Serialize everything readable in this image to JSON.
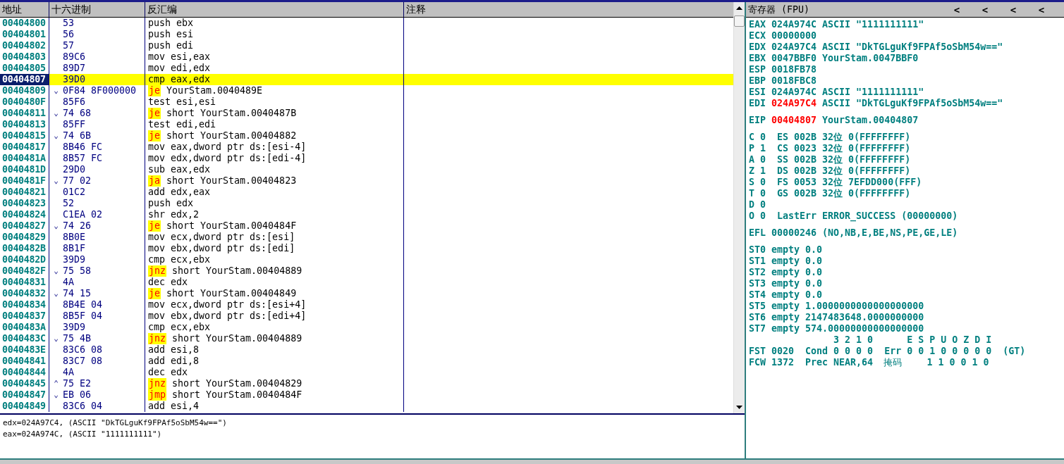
{
  "disassembly": {
    "columns": [
      "地址",
      "十六进制",
      "反汇编",
      "注释"
    ],
    "rows": [
      {
        "address": "00404800",
        "hex": "53",
        "kind": "plain",
        "instruction": "push ebx",
        "selected": false
      },
      {
        "address": "00404801",
        "hex": "56",
        "kind": "plain",
        "instruction": "push esi",
        "selected": false
      },
      {
        "address": "00404802",
        "hex": "57",
        "kind": "plain",
        "instruction": "push edi",
        "selected": false
      },
      {
        "address": "00404803",
        "hex": "89C6",
        "kind": "plain",
        "instruction": "mov esi,eax",
        "selected": false
      },
      {
        "address": "00404805",
        "hex": "89D7",
        "kind": "plain",
        "instruction": "mov edi,edx",
        "selected": false
      },
      {
        "address": "00404807",
        "hex": "39D0",
        "kind": "plain",
        "instruction": "cmp eax,edx",
        "selected": true
      },
      {
        "address": "00404809",
        "arrow": "⌄",
        "hex": "0F84 8F000000",
        "kind": "jump",
        "mnemonic": "je",
        "operands": "YourStam.0040489E",
        "selected": false
      },
      {
        "address": "0040480F",
        "hex": "85F6",
        "kind": "plain",
        "instruction": "test esi,esi",
        "selected": false
      },
      {
        "address": "00404811",
        "arrow": "⌄",
        "hex": "74 68",
        "kind": "jump",
        "mnemonic": "je",
        "operands": "short YourStam.0040487B",
        "selected": false
      },
      {
        "address": "00404813",
        "hex": "85FF",
        "kind": "plain",
        "instruction": "test edi,edi",
        "selected": false
      },
      {
        "address": "00404815",
        "arrow": "⌄",
        "hex": "74 6B",
        "kind": "jump",
        "mnemonic": "je",
        "operands": "short YourStam.00404882",
        "selected": false
      },
      {
        "address": "00404817",
        "hex": "8B46 FC",
        "kind": "plain",
        "instruction": "mov eax,dword ptr ds:[esi-4]",
        "selected": false
      },
      {
        "address": "0040481A",
        "hex": "8B57 FC",
        "kind": "plain",
        "instruction": "mov edx,dword ptr ds:[edi-4]",
        "selected": false
      },
      {
        "address": "0040481D",
        "hex": "29D0",
        "kind": "plain",
        "instruction": "sub eax,edx",
        "selected": false
      },
      {
        "address": "0040481F",
        "arrow": "⌄",
        "hex": "77 02",
        "kind": "jump",
        "mnemonic": "ja",
        "operands": "short YourStam.00404823",
        "selected": false
      },
      {
        "address": "00404821",
        "hex": "01C2",
        "kind": "plain",
        "instruction": "add edx,eax",
        "selected": false
      },
      {
        "address": "00404823",
        "hex": "52",
        "kind": "plain",
        "instruction": "push edx",
        "selected": false
      },
      {
        "address": "00404824",
        "hex": "C1EA 02",
        "kind": "plain",
        "instruction": "shr edx,2",
        "selected": false
      },
      {
        "address": "00404827",
        "arrow": "⌄",
        "hex": "74 26",
        "kind": "jump",
        "mnemonic": "je",
        "operands": "short YourStam.0040484F",
        "selected": false
      },
      {
        "address": "00404829",
        "hex": "8B0E",
        "kind": "plain",
        "instruction": "mov ecx,dword ptr ds:[esi]",
        "selected": false
      },
      {
        "address": "0040482B",
        "hex": "8B1F",
        "kind": "plain",
        "instruction": "mov ebx,dword ptr ds:[edi]",
        "selected": false
      },
      {
        "address": "0040482D",
        "hex": "39D9",
        "kind": "plain",
        "instruction": "cmp ecx,ebx",
        "selected": false
      },
      {
        "address": "0040482F",
        "arrow": "⌄",
        "hex": "75 58",
        "kind": "jump",
        "mnemonic": "jnz",
        "operands": "short YourStam.00404889",
        "selected": false
      },
      {
        "address": "00404831",
        "hex": "4A",
        "kind": "plain",
        "instruction": "dec edx",
        "selected": false
      },
      {
        "address": "00404832",
        "arrow": "⌄",
        "hex": "74 15",
        "kind": "jump",
        "mnemonic": "je",
        "operands": "short YourStam.00404849",
        "selected": false
      },
      {
        "address": "00404834",
        "hex": "8B4E 04",
        "kind": "plain",
        "instruction": "mov ecx,dword ptr ds:[esi+4]",
        "selected": false
      },
      {
        "address": "00404837",
        "hex": "8B5F 04",
        "kind": "plain",
        "instruction": "mov ebx,dword ptr ds:[edi+4]",
        "selected": false
      },
      {
        "address": "0040483A",
        "hex": "39D9",
        "kind": "plain",
        "instruction": "cmp ecx,ebx",
        "selected": false
      },
      {
        "address": "0040483C",
        "arrow": "⌄",
        "hex": "75 4B",
        "kind": "jump",
        "mnemonic": "jnz",
        "operands": "short YourStam.00404889",
        "selected": false
      },
      {
        "address": "0040483E",
        "hex": "83C6 08",
        "kind": "plain",
        "instruction": "add esi,8",
        "selected": false
      },
      {
        "address": "00404841",
        "hex": "83C7 08",
        "kind": "plain",
        "instruction": "add edi,8",
        "selected": false
      },
      {
        "address": "00404844",
        "hex": "4A",
        "kind": "plain",
        "instruction": "dec edx",
        "selected": false
      },
      {
        "address": "00404845",
        "arrow": "⌃",
        "hex": "75 E2",
        "kind": "jump",
        "mnemonic": "jnz",
        "operands": "short YourStam.00404829",
        "selected": false
      },
      {
        "address": "00404847",
        "arrow": "⌄",
        "hex": "EB 06",
        "kind": "jump",
        "mnemonic": "jmp",
        "operands": "short YourStam.0040484F",
        "selected": false
      },
      {
        "address": "00404849",
        "hex": "83C6 04",
        "kind": "plain",
        "instruction": "add esi,4",
        "selected": false
      }
    ]
  },
  "info": [
    "edx=024A97C4, (ASCII \"DkTGLguKf9FPAf5oSbM54w==\")",
    "eax=024A974C, (ASCII \"1111111111\")"
  ],
  "registers": {
    "title": "寄存器 (FPU)",
    "nav_buttons": [
      "<",
      "<",
      "<",
      "<"
    ],
    "general": [
      {
        "name": "EAX",
        "value": "024A974C",
        "changed": false,
        "note": "ASCII \"1111111111\""
      },
      {
        "name": "ECX",
        "value": "00000000",
        "changed": false
      },
      {
        "name": "EDX",
        "value": "024A97C4",
        "changed": false,
        "note": "ASCII \"DkTGLguKf9FPAf5oSbM54w==\""
      },
      {
        "name": "EBX",
        "value": "0047BBF0",
        "changed": false,
        "note": "YourStam.0047BBF0"
      },
      {
        "name": "ESP",
        "value": "0018FB78",
        "changed": false
      },
      {
        "name": "EBP",
        "value": "0018FBC8",
        "changed": false
      },
      {
        "name": "ESI",
        "value": "024A974C",
        "changed": false,
        "note": "ASCII \"1111111111\""
      },
      {
        "name": "EDI",
        "value": "024A97C4",
        "changed": true,
        "note": "ASCII \"DkTGLguKf9FPAf5oSbM54w==\""
      }
    ],
    "eip": {
      "name": "EIP",
      "value": "00404807",
      "changed": true,
      "note": "YourStam.00404807"
    },
    "flags": [
      {
        "flag": "C",
        "value": "0",
        "detail": "ES 002B 32位 0(FFFFFFFF)"
      },
      {
        "flag": "P",
        "value": "1",
        "detail": "CS 0023 32位 0(FFFFFFFF)"
      },
      {
        "flag": "A",
        "value": "0",
        "detail": "SS 002B 32位 0(FFFFFFFF)"
      },
      {
        "flag": "Z",
        "value": "1",
        "detail": "DS 002B 32位 0(FFFFFFFF)"
      },
      {
        "flag": "S",
        "value": "0",
        "detail": "FS 0053 32位 7EFDD000(FFF)"
      },
      {
        "flag": "T",
        "value": "0",
        "detail": "GS 002B 32位 0(FFFFFFFF)"
      },
      {
        "flag": "D",
        "value": "0"
      },
      {
        "flag": "O",
        "value": "0",
        "detail": "LastErr ERROR_SUCCESS (00000000)"
      }
    ],
    "efl": {
      "name": "EFL",
      "value": "00000246",
      "note": "(NO,NB,E,BE,NS,PE,GE,LE)"
    },
    "fpu_stack": [
      {
        "name": "ST0",
        "tag": "empty",
        "value": "0.0"
      },
      {
        "name": "ST1",
        "tag": "empty",
        "value": "0.0"
      },
      {
        "name": "ST2",
        "tag": "empty",
        "value": "0.0"
      },
      {
        "name": "ST3",
        "tag": "empty",
        "value": "0.0"
      },
      {
        "name": "ST4",
        "tag": "empty",
        "value": "0.0"
      },
      {
        "name": "ST5",
        "tag": "empty",
        "value": "1.0000000000000000000"
      },
      {
        "name": "ST6",
        "tag": "empty",
        "value": "2147483648.0000000000"
      },
      {
        "name": "ST7",
        "tag": "empty",
        "value": "574.00000000000000000"
      }
    ],
    "bit_header": "3 2 1 0      E S P U O Z D I",
    "fst": "FST 0020  Cond 0 0 0 0  Err 0 0 1 0 0 0 0 0  (GT)",
    "fcw": [
      "FCW 1372  Prec NEAR,64",
      "掩码",
      "1 1 0 0 1 0"
    ]
  }
}
